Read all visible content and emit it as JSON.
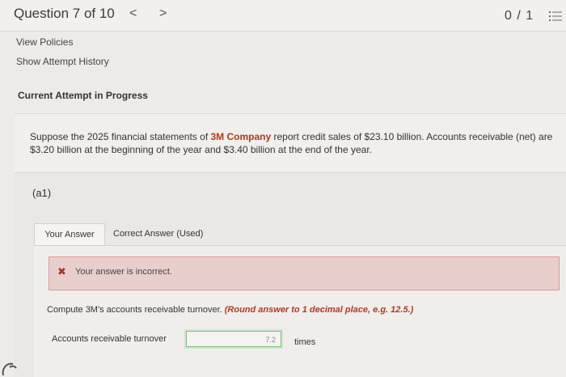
{
  "header": {
    "question_title": "Question 7 of 10",
    "prev_glyph": "<",
    "next_glyph": ">",
    "score": "0 / 1",
    "list_icon": "list-icon"
  },
  "links": {
    "view_policies": "View Policies",
    "show_attempt_history": "Show Attempt History"
  },
  "current_attempt": "Current Attempt in Progress",
  "question": {
    "text_before": "Suppose the 2025 financial statements of ",
    "company": "3M Company",
    "text_after": " report credit sales of $23.10 billion. Accounts receivable (net) are $3.20 billion at the beginning of the year and $3.40 billion at the end of the year."
  },
  "part": {
    "label": "(a1)",
    "tabs": [
      {
        "label": "Your Answer"
      },
      {
        "label": "Correct Answer (Used)"
      }
    ],
    "feedback": {
      "icon": "x-icon",
      "message": "Your answer is incorrect."
    },
    "instruction": {
      "text": "Compute 3M's accounts receivable turnover. ",
      "round_note": "(Round answer to 1 decimal place, e.g. 12.5.)"
    },
    "answer": {
      "label": "Accounts receivable turnover",
      "value": "7.2",
      "unit": "times"
    }
  },
  "colors": {
    "error_red": "#b13a22",
    "error_bg": "#e9cfcc",
    "input_border": "#7cbf7c"
  }
}
